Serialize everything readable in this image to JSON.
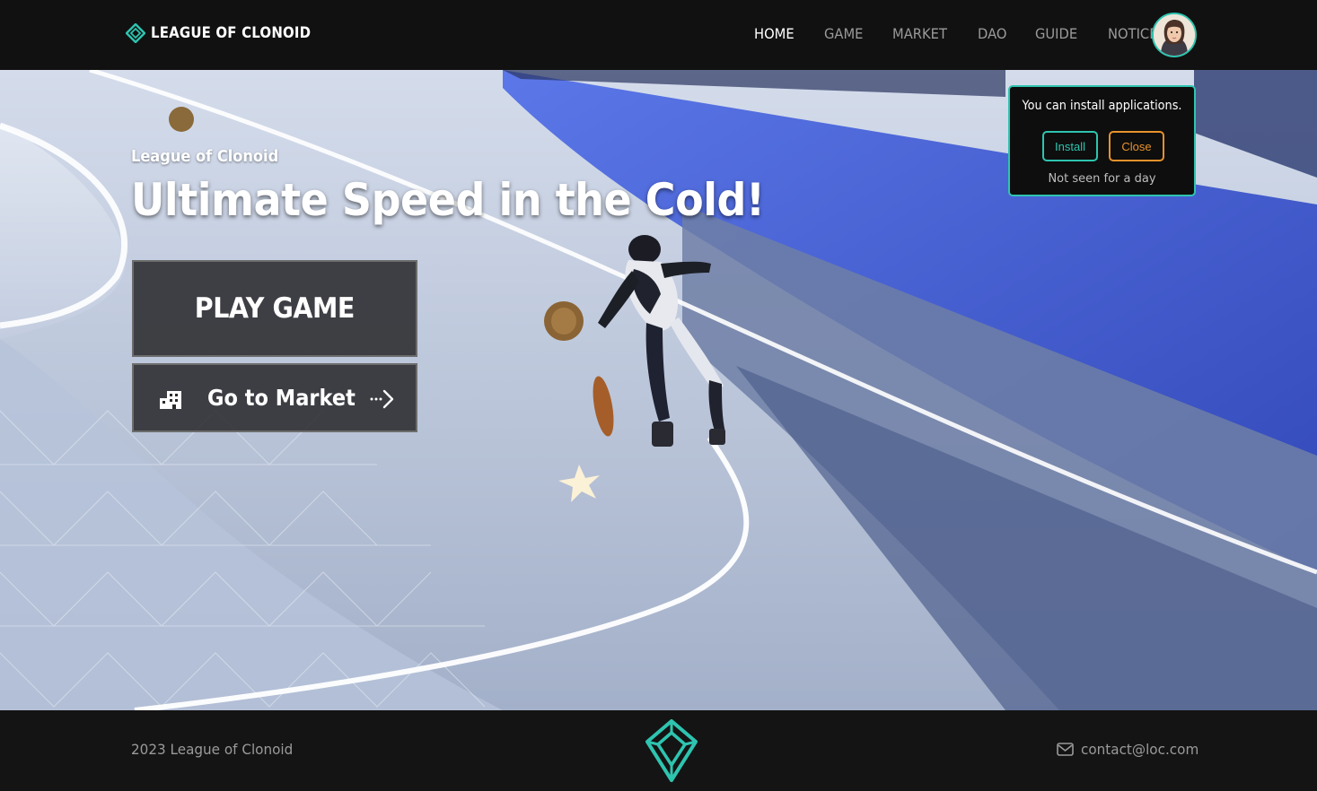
{
  "header": {
    "logo_text": "LEAGUE OF CLONOID",
    "nav": [
      {
        "label": "HOME",
        "active": true
      },
      {
        "label": "GAME",
        "active": false
      },
      {
        "label": "MARKET",
        "active": false
      },
      {
        "label": "DAO",
        "active": false
      },
      {
        "label": "GUIDE",
        "active": false
      },
      {
        "label": "NOTICE",
        "active": false
      }
    ]
  },
  "hero": {
    "kicker": "League of Clonoid",
    "title": "Ultimate Speed in the Cold!",
    "play_button": "PLAY GAME",
    "market_button": "Go to Market"
  },
  "install_popup": {
    "message": "You can install applications.",
    "install_label": "Install",
    "close_label": "Close",
    "dismiss_label": "Not seen for a day"
  },
  "footer": {
    "copyright": "2023 League of Clonoid",
    "contact_email": "contact@loc.com"
  },
  "colors": {
    "accent": "#2ec4b0",
    "close_orange": "#e8922c",
    "header_bg": "#111111"
  }
}
